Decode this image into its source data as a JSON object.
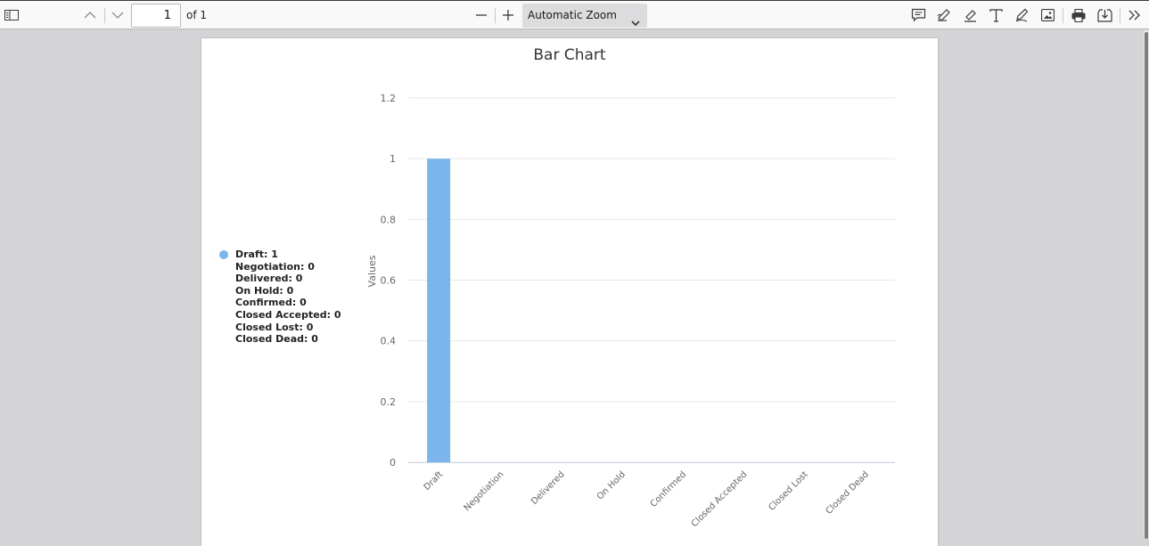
{
  "toolbar": {
    "page_number": "1",
    "page_of": "of 1",
    "zoom_label": "Automatic Zoom"
  },
  "legend": {
    "items": [
      "Draft: 1",
      "Negotiation: 0",
      "Delivered: 0",
      "On Hold: 0",
      "Confirmed: 0",
      "Closed Accepted: 0",
      "Closed Lost: 0",
      "Closed Dead: 0"
    ]
  },
  "colors": {
    "bar": "#7cb5ec",
    "grid": "#e6e6e6",
    "axis_text": "#666666"
  },
  "chart_data": {
    "type": "bar",
    "title": "Bar Chart",
    "xlabel": "",
    "ylabel": "Values",
    "categories": [
      "Draft",
      "Negotiation",
      "Delivered",
      "On Hold",
      "Confirmed",
      "Closed Accepted",
      "Closed Lost",
      "Closed Dead"
    ],
    "values": [
      1,
      0,
      0,
      0,
      0,
      0,
      0,
      0
    ],
    "ylim": [
      0,
      1.2
    ],
    "yticks": [
      "0",
      "0.2",
      "0.4",
      "0.6",
      "0.8",
      "1",
      "1.2"
    ],
    "grid": true,
    "legend_position": "left"
  }
}
